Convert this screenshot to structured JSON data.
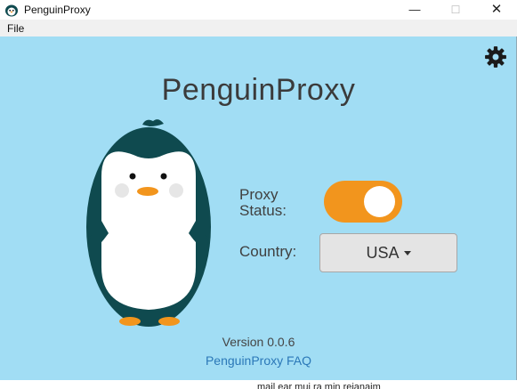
{
  "window": {
    "title": "PenguinProxy",
    "controls": {
      "minimize": "—",
      "maximize": "☐",
      "close": "✕"
    }
  },
  "menu": {
    "file": "File"
  },
  "main": {
    "app_title": "PenguinProxy",
    "proxy_status_label_line1": "Proxy",
    "proxy_status_label_line2": "Status:",
    "proxy_enabled": true,
    "country_label": "Country:",
    "country_value": "USA",
    "version": "Version 0.0.6",
    "faq_link": "PenguinProxy FAQ"
  },
  "background_window_text": "mail ear mui ra min reianaim",
  "icons": {
    "settings": "gear-icon",
    "mascot": "penguin-mascot",
    "app": "penguin-app-icon"
  },
  "colors": {
    "background": "#a1ddf4",
    "toggle_on": "#f2951d",
    "penguin_body": "#0f4a4f",
    "link": "#2b78b8"
  }
}
